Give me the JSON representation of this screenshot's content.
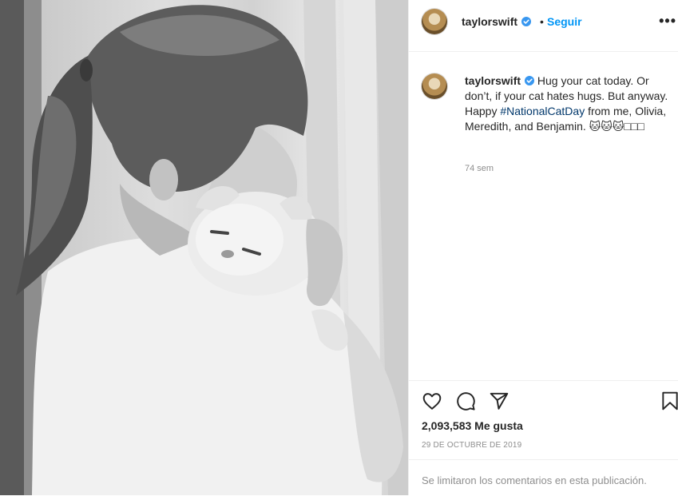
{
  "post": {
    "username": "taylorswift",
    "follow_label": "Seguir",
    "separator": "•",
    "more_label": "•••",
    "caption": {
      "text_before": "Hug your cat today. Or don’t, if your cat hates hugs. But anyway. Happy ",
      "hashtag": "#NationalCatDay",
      "text_after": " from me, Olivia, Meredith, and Benjamin. 🐱🐱🐱□□□"
    },
    "post_age": "74 sem",
    "likes": "2,093,583 Me gusta",
    "date": "29 DE OCTUBRE DE 2019",
    "comments_disabled": "Se limitaron los comentarios en esta publicación."
  },
  "icons": {
    "verified": "verified-badge-icon",
    "like": "heart-icon",
    "comment": "comment-bubble-icon",
    "share": "paper-plane-icon",
    "save": "bookmark-icon",
    "more": "more-options-icon"
  },
  "colors": {
    "link": "#0095f6",
    "verified": "#3897f0",
    "hashtag": "#00376b",
    "muted": "#8e8e8e",
    "text": "#262626"
  }
}
